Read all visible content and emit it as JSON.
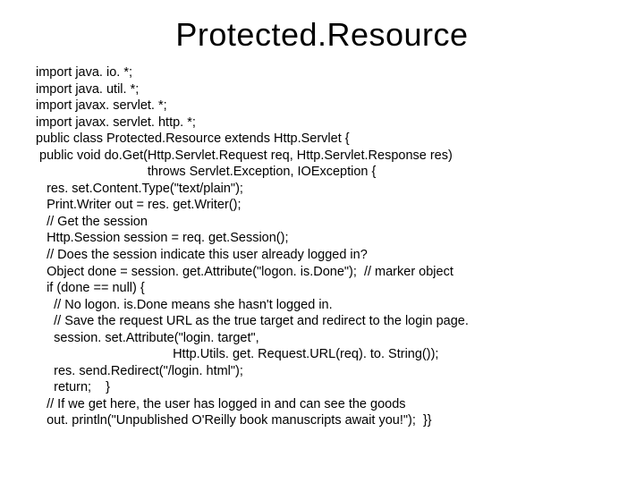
{
  "title": "Protected.Resource",
  "code_lines": [
    "import java. io. *;",
    "import java. util. *;",
    "import javax. servlet. *;",
    "import javax. servlet. http. *;",
    "public class Protected.Resource extends Http.Servlet {",
    " public void do.Get(Http.Servlet.Request req, Http.Servlet.Response res)",
    "                               throws Servlet.Exception, IOException {",
    "   res. set.Content.Type(\"text/plain\");",
    "   Print.Writer out = res. get.Writer();",
    "   // Get the session",
    "   Http.Session session = req. get.Session();",
    "   // Does the session indicate this user already logged in?",
    "   Object done = session. get.Attribute(\"logon. is.Done\");  // marker object",
    "   if (done == null) {",
    "     // No logon. is.Done means she hasn't logged in.",
    "     // Save the request URL as the true target and redirect to the login page.",
    "     session. set.Attribute(\"login. target\",",
    "                                      Http.Utils. get. Request.URL(req). to. String());",
    "     res. send.Redirect(\"/login. html\");",
    "     return;    }",
    "   // If we get here, the user has logged in and can see the goods",
    "   out. println(\"Unpublished O'Reilly book manuscripts await you!\");  }}"
  ]
}
